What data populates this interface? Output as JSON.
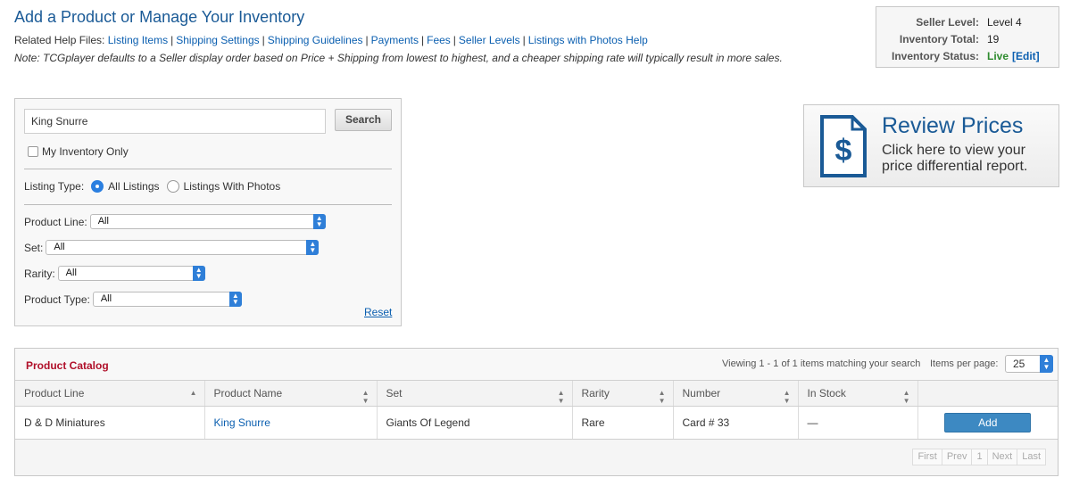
{
  "header": {
    "title": "Add a Product or Manage Your Inventory",
    "help_label": "Related Help Files:",
    "help_links": [
      "Listing Items",
      "Shipping Settings",
      "Shipping Guidelines",
      "Payments",
      "Fees",
      "Seller Levels",
      "Listings with Photos Help"
    ],
    "note": "Note: TCGplayer defaults to a Seller display order based on Price + Shipping from lowest to highest, and a cheaper shipping rate will typically result in more sales."
  },
  "seller": {
    "level_label": "Seller Level:",
    "level_value": "Level 4",
    "total_label": "Inventory Total:",
    "total_value": "19",
    "status_label": "Inventory Status:",
    "status_value": "Live",
    "edit_label": "[Edit]",
    "status_color": "#2e8b2e"
  },
  "search": {
    "query": "King Snurre",
    "button_label": "Search",
    "my_inventory_label": "My Inventory Only",
    "my_inventory_checked": false,
    "listing_type_label": "Listing Type:",
    "listing_options": [
      "All Listings",
      "Listings With Photos"
    ],
    "listing_selected": "All Listings",
    "filters": {
      "product_line": {
        "label": "Product Line:",
        "value": "All"
      },
      "set": {
        "label": "Set:",
        "value": "All"
      },
      "rarity": {
        "label": "Rarity:",
        "value": "All"
      },
      "product_type": {
        "label": "Product Type:",
        "value": "All"
      }
    },
    "reset_label": "Reset"
  },
  "review": {
    "title": "Review Prices",
    "subtitle": "Click here to view your price differential report.",
    "icon": "dollar-document-icon"
  },
  "catalog": {
    "title": "Product Catalog",
    "viewing_text": "Viewing 1 - 1 of 1 items matching your search",
    "items_per_page_label": "Items per page:",
    "items_per_page_value": "25",
    "columns": [
      "Product Line",
      "Product Name",
      "Set",
      "Rarity",
      "Number",
      "In Stock",
      ""
    ],
    "rows": [
      {
        "product_line": "D & D Miniatures",
        "product_name": "King Snurre",
        "set": "Giants Of Legend",
        "rarity": "Rare",
        "number": "Card # 33",
        "in_stock": "—",
        "action": "Add"
      }
    ],
    "pager": [
      "First",
      "Prev",
      "1",
      "Next",
      "Last"
    ]
  },
  "colors": {
    "link": "#0b5fb0",
    "title": "#1a5a96",
    "catalog_title": "#b0102a",
    "add_button": "#3d89c2"
  }
}
